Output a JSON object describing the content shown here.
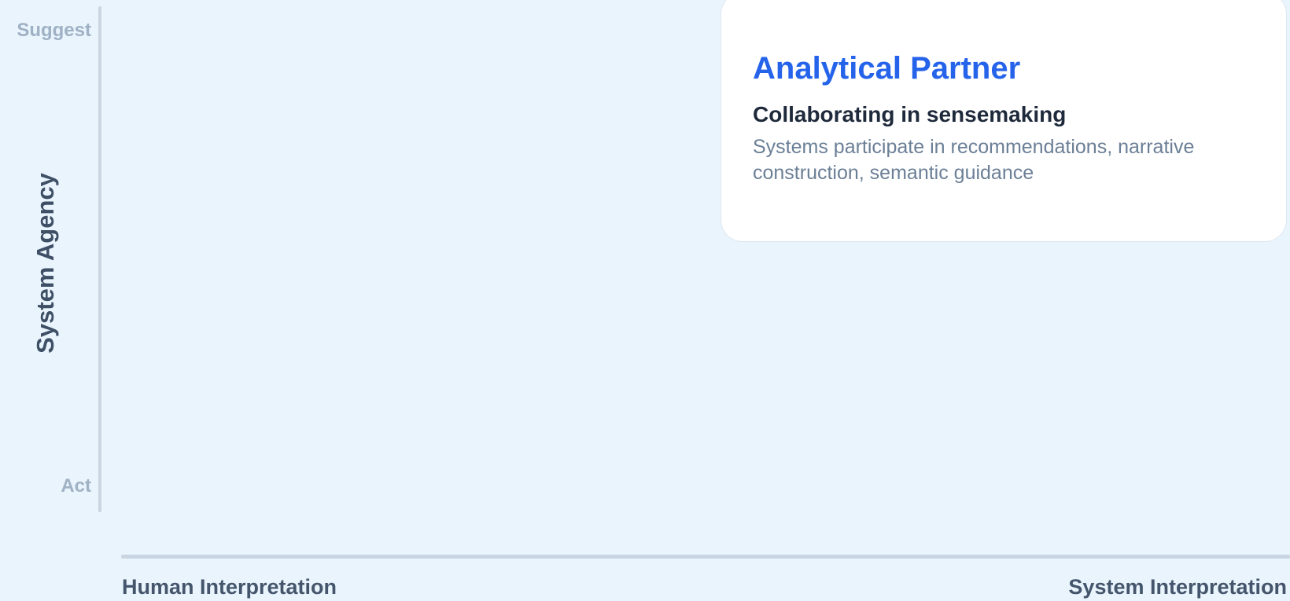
{
  "y_axis": {
    "title": "System Agency",
    "top_label": "Suggest",
    "bottom_label": "Act"
  },
  "x_axis": {
    "left_label": "Human Interpretation",
    "right_label": "System Interpretation"
  },
  "card": {
    "title": "Analytical Partner",
    "subtitle": "Collaborating in sensemaking",
    "description": "Systems participate in recommendations, narrative construction, semantic guidance"
  },
  "colors": {
    "background": "#e9f4fd",
    "accent": "#2563eb",
    "axis": "#cad5e2"
  }
}
